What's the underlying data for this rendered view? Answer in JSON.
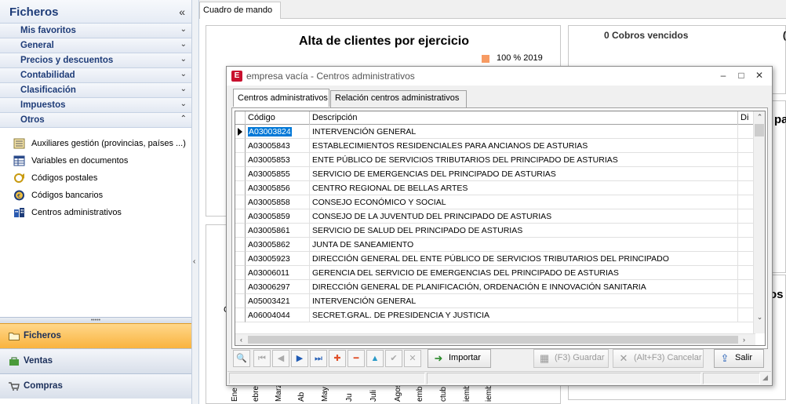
{
  "sidebar": {
    "title": "Ficheros",
    "collapse_glyph": "«",
    "groups": [
      {
        "label": "Mis favoritos",
        "chevron": "⌄"
      },
      {
        "label": "General",
        "chevron": "⌄"
      },
      {
        "label": "Precios y descuentos",
        "chevron": "⌄"
      },
      {
        "label": "Contabilidad",
        "chevron": "⌄"
      },
      {
        "label": "Clasificación",
        "chevron": "⌄"
      },
      {
        "label": "Impuestos",
        "chevron": "⌄"
      },
      {
        "label": "Otros",
        "chevron": "⌃"
      }
    ],
    "items": [
      {
        "label": "Auxiliares gestión (provincias, países ...)",
        "icon": "list-icon"
      },
      {
        "label": "Variables en documentos",
        "icon": "table-icon"
      },
      {
        "label": "Códigos postales",
        "icon": "postal-horn-icon"
      },
      {
        "label": "Códigos bancarios",
        "icon": "euro-coin-icon"
      },
      {
        "label": "Centros administrativos",
        "icon": "buildings-icon"
      }
    ],
    "modules": [
      {
        "label": "Ficheros",
        "icon": "folder-icon"
      },
      {
        "label": "Ventas",
        "icon": "bag-icon"
      },
      {
        "label": "Compras",
        "icon": "cart-icon"
      }
    ],
    "splitter_glyph": "‹",
    "grip_glyph": "•••••"
  },
  "main": {
    "tab_label": "Cuadro de mando",
    "chart_title": "Alta de clientes por ejercicio",
    "legend_label": "100 % 2019",
    "cobros_title": "0  Cobros vencidos",
    "months": [
      "Ene",
      "ebre",
      "Marz",
      "Ab",
      "May",
      "Ju",
      "Juli",
      "Agos",
      "embr",
      "ctub",
      "iemb",
      "iemb"
    ],
    "right_fragment_1": "pa",
    "right_fragment_2": "os",
    "left_fragment": "C",
    "far_right_fragment": "("
  },
  "dialog": {
    "app_icon_letter": "E",
    "title": "empresa vacía - Centros administrativos",
    "controls": {
      "minimize": "–",
      "maximize": "□",
      "close": "✕"
    },
    "tabs": [
      "Centros administrativos",
      "Relación centros administrativos"
    ],
    "columns": [
      "Código",
      "Descripción",
      "Di"
    ],
    "rows": [
      {
        "code": "A03003824",
        "desc": "INTERVENCIÓN GENERAL"
      },
      {
        "code": "A03005843",
        "desc": "ESTABLECIMIENTOS RESIDENCIALES PARA ANCIANOS DE ASTURIAS"
      },
      {
        "code": "A03005853",
        "desc": "ENTE PÚBLICO DE SERVICIOS TRIBUTARIOS DEL PRINCIPADO DE ASTURIAS"
      },
      {
        "code": "A03005855",
        "desc": "SERVICIO DE EMERGENCIAS DEL PRINCIPADO DE ASTURIAS"
      },
      {
        "code": "A03005856",
        "desc": "CENTRO REGIONAL DE BELLAS ARTES"
      },
      {
        "code": "A03005858",
        "desc": "CONSEJO ECONÓMICO Y SOCIAL"
      },
      {
        "code": "A03005859",
        "desc": "CONSEJO DE LA JUVENTUD DEL PRINCIPADO DE ASTURIAS"
      },
      {
        "code": "A03005861",
        "desc": "SERVICIO DE SALUD DEL PRINCIPADO DE ASTURIAS"
      },
      {
        "code": "A03005862",
        "desc": "JUNTA DE SANEAMIENTO"
      },
      {
        "code": "A03005923",
        "desc": "DIRECCIÓN GENERAL DEL ENTE PÚBLICO DE SERVICIOS TRIBUTARIOS DEL PRINCIPADO"
      },
      {
        "code": "A03006011",
        "desc": "GERENCIA DEL SERVICIO DE EMERGENCIAS DEL PRINCIPADO DE ASTURIAS"
      },
      {
        "code": "A03006297",
        "desc": "DIRECCIÓN GENERAL DE PLANIFICACIÓN, ORDENACIÓN E INNOVACIÓN SANITARIA"
      },
      {
        "code": "A05003421",
        "desc": "INTERVENCIÓN GENERAL"
      },
      {
        "code": "A06004044",
        "desc": "SECRET.GRAL. DE PRESIDENCIA Y JUSTICIA"
      }
    ],
    "scroll_glyphs": {
      "up": "⌃",
      "down": "⌄",
      "left": "‹",
      "right": "›"
    },
    "nav_buttons": [
      {
        "name": "search",
        "glyph": "🔍"
      },
      {
        "name": "first",
        "glyph": "⏮"
      },
      {
        "name": "prev",
        "glyph": "◀"
      },
      {
        "name": "next",
        "glyph": "▶"
      },
      {
        "name": "last",
        "glyph": "⏭"
      },
      {
        "name": "add",
        "glyph": "✚"
      },
      {
        "name": "delete",
        "glyph": "━"
      },
      {
        "name": "up",
        "glyph": "▲"
      },
      {
        "name": "confirm",
        "glyph": "✔"
      },
      {
        "name": "cancel-edit",
        "glyph": "✕"
      }
    ],
    "buttons": {
      "import": "Importar",
      "import_icon": "➜",
      "save": "(F3) Guardar",
      "save_icon": "▦",
      "cancel": "(Alt+F3) Cancelar",
      "cancel_icon": "✕",
      "exit": "Salir",
      "exit_icon": "⇪"
    },
    "resize_grip": "◢"
  },
  "colors": {
    "accent_orange": "#f9b33e",
    "selection_blue": "#0078d7",
    "sidebar_text": "#1e3c78",
    "pie_orange": "#f79b63"
  }
}
